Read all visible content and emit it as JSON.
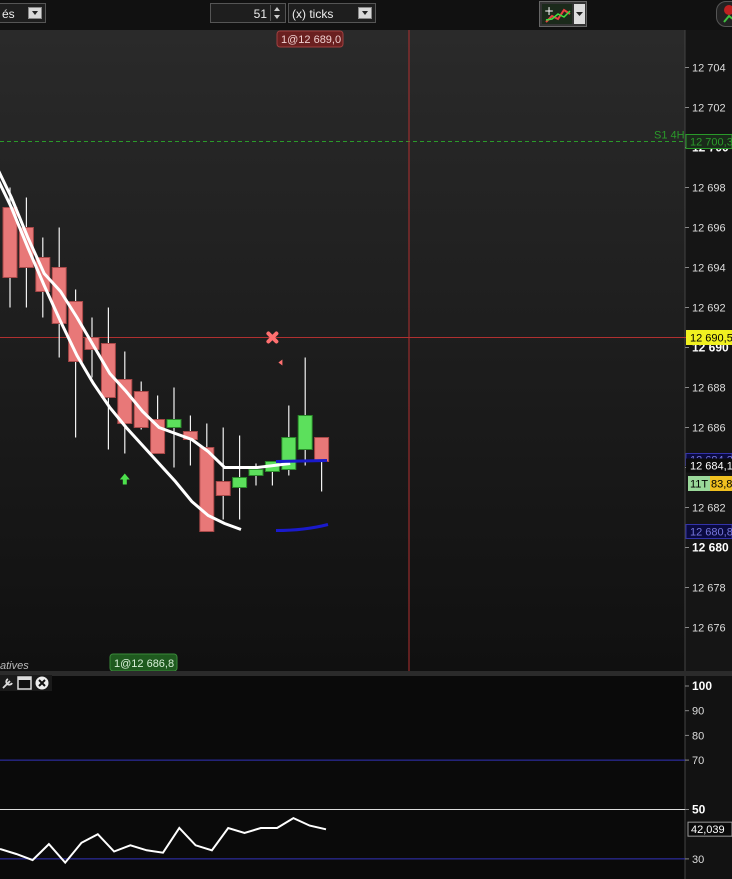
{
  "toolbar": {
    "left_select_text": "és",
    "period_value": "51",
    "period_unit": "(x) ticks"
  },
  "price_panel": {
    "top_marker_label": "1@12 689,0",
    "bottom_marker_label": "1@12 686,8",
    "corner_text": "atives",
    "level_line_label": "S1 4H",
    "level_line_value": "12 700,3",
    "cursor_price_label": "12 690,5",
    "last_price_label": "12 684,1",
    "tick_counter_label": "11T",
    "tick_counter_value": "83,8",
    "blue_tag_upper": "12 684,3",
    "blue_tag_lower": "12 680,8"
  },
  "oscillator_panel": {
    "value_label": "42,039"
  },
  "colors": {
    "bull_candle": "#5ce05c",
    "bear_candle": "#e87878",
    "ma_line": "#ffffff",
    "projection_line": "#1a1acc",
    "level_line": "#2a9a2a",
    "crosshair": "#b03030",
    "oscillator_band": "#3333bb"
  },
  "chart_data": [
    {
      "type": "candlestick",
      "title": "",
      "ylim": [
        12674.5,
        12706.5
      ],
      "y_ticks": [
        12704,
        12702,
        12700,
        12698,
        12696,
        12694,
        12692,
        12690,
        12688,
        12686,
        12684,
        12682,
        12680,
        12678,
        12676
      ],
      "y_tick_labels": [
        "12 704",
        "12 702",
        "12 700",
        "12 698",
        "12 696",
        "12 694",
        "12 692",
        "12 690",
        "12 688",
        "12 686",
        "12 684",
        "12 682",
        "12 680",
        "12 678",
        "12 676"
      ],
      "candles": [
        {
          "o": 12697.0,
          "h": 12698.0,
          "l": 12692.0,
          "c": 12693.5
        },
        {
          "o": 12696.0,
          "h": 12697.5,
          "l": 12692.0,
          "c": 12694.0
        },
        {
          "o": 12694.5,
          "h": 12695.5,
          "l": 12691.5,
          "c": 12692.8
        },
        {
          "o": 12694.0,
          "h": 12696.0,
          "l": 12689.5,
          "c": 12691.2
        },
        {
          "o": 12692.3,
          "h": 12692.9,
          "l": 12685.5,
          "c": 12689.3
        },
        {
          "o": 12690.5,
          "h": 12691.5,
          "l": 12688.5,
          "c": 12689.9
        },
        {
          "o": 12690.2,
          "h": 12692.0,
          "l": 12684.9,
          "c": 12687.5
        },
        {
          "o": 12688.4,
          "h": 12689.8,
          "l": 12684.7,
          "c": 12686.2
        },
        {
          "o": 12687.8,
          "h": 12688.3,
          "l": 12685.9,
          "c": 12686.0
        },
        {
          "o": 12686.4,
          "h": 12687.6,
          "l": 12685.3,
          "c": 12684.7
        },
        {
          "o": 12686.0,
          "h": 12688.0,
          "l": 12684.0,
          "c": 12686.4
        },
        {
          "o": 12685.8,
          "h": 12686.6,
          "l": 12684.1,
          "c": 12685.4
        },
        {
          "o": 12685.0,
          "h": 12686.2,
          "l": 12681.0,
          "c": 12680.8
        },
        {
          "o": 12683.3,
          "h": 12686.0,
          "l": 12681.4,
          "c": 12682.6
        },
        {
          "o": 12683.0,
          "h": 12685.6,
          "l": 12681.4,
          "c": 12683.5
        },
        {
          "o": 12683.6,
          "h": 12684.2,
          "l": 12683.1,
          "c": 12683.9
        },
        {
          "o": 12683.8,
          "h": 12684.3,
          "l": 12683.1,
          "c": 12684.3
        },
        {
          "o": 12683.9,
          "h": 12687.1,
          "l": 12683.6,
          "c": 12685.5
        },
        {
          "o": 12684.9,
          "h": 12689.5,
          "l": 12684.1,
          "c": 12686.6
        },
        {
          "o": 12685.5,
          "h": 12685.5,
          "l": 12682.8,
          "c": 12684.3
        }
      ],
      "moving_average_fast": [
        12699.2,
        12697.5,
        12695.5,
        12693.7,
        12692.8,
        12691.5,
        12690.1,
        12688.7,
        12687.8,
        12686.8,
        12686.0,
        12685.7,
        12685.4,
        12684.8,
        12684.0,
        12684.0,
        12684.0,
        12684.1,
        12684.2
      ],
      "moving_average_slow": [
        12698.7,
        12697.0,
        12695.0,
        12693.1,
        12691.3,
        12689.6,
        12688.2,
        12687.0,
        12686.0,
        12685.1,
        12684.2,
        12683.3,
        12682.3,
        12681.6,
        12681.2,
        12680.9
      ],
      "level_line": 12700.3,
      "cursor_price": 12690.5,
      "last_price": 12684.1,
      "markers": [
        {
          "type": "up-arrow",
          "index": 7,
          "price": 12683.4
        },
        {
          "type": "x-cross",
          "index": 16,
          "price": 12690.5
        },
        {
          "type": "small-triangle",
          "index": 16,
          "price": 12689.1
        }
      ]
    },
    {
      "type": "line",
      "title": "",
      "ylim": [
        26,
        104
      ],
      "y_ticks": [
        100,
        90,
        80,
        70,
        50,
        30
      ],
      "y_tick_labels": [
        "100",
        "90",
        "80",
        "70",
        "50",
        "30"
      ],
      "bands": [
        70,
        50,
        30
      ],
      "values": [
        34.0,
        32.0,
        29.5,
        36.0,
        28.5,
        36.5,
        40.0,
        33.0,
        35.5,
        33.5,
        32.5,
        42.5,
        35.5,
        33.5,
        42.5,
        40.5,
        42.5,
        42.5,
        46.5,
        43.5,
        42.0
      ],
      "last_value": 42.039
    }
  ]
}
